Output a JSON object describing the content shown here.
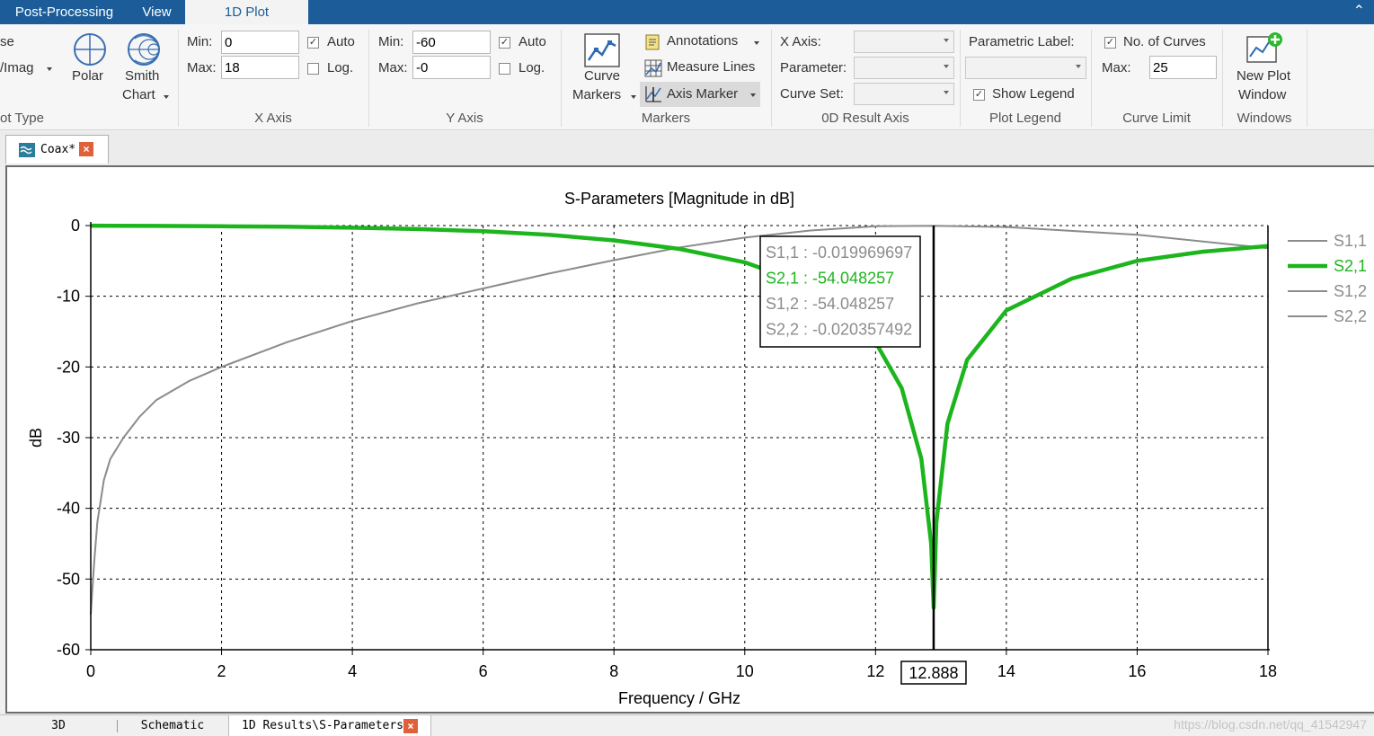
{
  "tabs": {
    "post_processing": "Post-Processing",
    "view": "View",
    "plot1d": "1D Plot"
  },
  "ribbon": {
    "plot_type": {
      "row1_partial": "se",
      "row2_partial": "/Imag",
      "label_partial": "ot Type",
      "polar": "Polar",
      "smith_line1": "Smith",
      "smith_line2": "Chart"
    },
    "x_axis": {
      "min_label": "Min:",
      "min_value": "0",
      "max_label": "Max:",
      "max_value": "18",
      "auto_label": "Auto",
      "auto_checked": true,
      "log_label": "Log.",
      "log_checked": false,
      "group_label": "X Axis"
    },
    "y_axis": {
      "min_label": "Min:",
      "min_value": "-60",
      "max_label": "Max:",
      "max_value": "-0",
      "auto_label": "Auto",
      "auto_checked": true,
      "log_label": "Log.",
      "log_checked": false,
      "group_label": "Y Axis"
    },
    "markers": {
      "curve_line1": "Curve",
      "curve_line2": "Markers",
      "annotations": "Annotations",
      "measure_lines": "Measure Lines",
      "axis_marker": "Axis Marker",
      "group_label": "Markers"
    },
    "result_axis": {
      "x_axis_label": "X Axis:",
      "parameter_label": "Parameter:",
      "curve_set_label": "Curve Set:",
      "group_label": "0D Result Axis"
    },
    "plot_legend": {
      "parametric_label": "Parametric Label:",
      "show_legend": "Show Legend",
      "show_legend_checked": true,
      "group_label": "Plot Legend"
    },
    "curve_limit": {
      "no_of_curves": "No. of Curves",
      "no_of_curves_checked": true,
      "max_label": "Max:",
      "max_value": "25",
      "group_label": "Curve Limit"
    },
    "windows": {
      "new_plot_line1": "New Plot",
      "new_plot_line2": "Window",
      "group_label": "Windows"
    }
  },
  "doc_tab": {
    "label": "Coax*",
    "close": "×"
  },
  "bottom_tabs": {
    "tab_3d": "3D",
    "schematic": "Schematic",
    "results": "1D Results\\S-Parameters",
    "close": "×"
  },
  "watermark": "https://blog.csdn.net/qq_41542947",
  "colors": {
    "ribbon_blue": "#1c5d99",
    "s21_green": "#1db51d",
    "gray_curve": "#8c8c8c",
    "tooltip_green": "#1db51d"
  },
  "chart_data": {
    "type": "line",
    "title": "S-Parameters [Magnitude in dB]",
    "xlabel": "Frequency / GHz",
    "ylabel": "dB",
    "xlim": [
      0,
      18
    ],
    "ylim": [
      -60,
      0
    ],
    "xticks": [
      0,
      2,
      4,
      6,
      8,
      10,
      12,
      14,
      16,
      18
    ],
    "yticks": [
      0,
      -10,
      -20,
      -30,
      -40,
      -50,
      -60
    ],
    "grid": true,
    "legend_position": "right",
    "legend": [
      "S1,1",
      "S2,1",
      "S1,2",
      "S2,2"
    ],
    "series": [
      {
        "name": "S1,1",
        "x": [
          0,
          0.05,
          0.1,
          0.2,
          0.3,
          0.5,
          0.75,
          1,
          1.5,
          2,
          3,
          4,
          5,
          6,
          7,
          8,
          9,
          10,
          11,
          12,
          12.888,
          14,
          16,
          18
        ],
        "values": [
          -55,
          -48,
          -42,
          -36,
          -33,
          -30,
          -27,
          -24.7,
          -22,
          -20,
          -16.5,
          -13.5,
          -11,
          -8.9,
          -6.8,
          -4.9,
          -3.1,
          -1.7,
          -0.7,
          -0.1,
          -0.02,
          -0.2,
          -1.3,
          -3.2
        ]
      },
      {
        "name": "S2,1",
        "x": [
          0,
          1,
          2,
          3,
          4,
          5,
          6,
          7,
          8,
          9,
          10,
          11,
          11.5,
          12,
          12.4,
          12.7,
          12.85,
          12.888,
          12.93,
          13.1,
          13.4,
          14,
          15,
          16,
          17,
          18
        ],
        "values": [
          -0.01,
          -0.05,
          -0.1,
          -0.15,
          -0.3,
          -0.5,
          -0.8,
          -1.3,
          -2.1,
          -3.3,
          -5.2,
          -8.5,
          -11.5,
          -16.5,
          -23,
          -33,
          -45,
          -54.05,
          -42,
          -28,
          -19,
          -12,
          -7.5,
          -5,
          -3.7,
          -2.9
        ]
      },
      {
        "name": "S1,2",
        "x": [
          0,
          1,
          2,
          3,
          4,
          5,
          6,
          7,
          8,
          9,
          10,
          11,
          11.5,
          12,
          12.4,
          12.7,
          12.85,
          12.888,
          12.93,
          13.1,
          13.4,
          14,
          15,
          16,
          17,
          18
        ],
        "values": [
          -0.01,
          -0.05,
          -0.1,
          -0.15,
          -0.3,
          -0.5,
          -0.8,
          -1.3,
          -2.1,
          -3.3,
          -5.2,
          -8.5,
          -11.5,
          -16.5,
          -23,
          -33,
          -45,
          -54.05,
          -42,
          -28,
          -19,
          -12,
          -7.5,
          -5,
          -3.7,
          -2.9
        ]
      },
      {
        "name": "S2,2",
        "x": [
          0,
          0.05,
          0.1,
          0.2,
          0.3,
          0.5,
          0.75,
          1,
          1.5,
          2,
          3,
          4,
          5,
          6,
          7,
          8,
          9,
          10,
          11,
          12,
          12.888,
          14,
          16,
          18
        ],
        "values": [
          -55,
          -48,
          -42,
          -36,
          -33,
          -30,
          -27,
          -24.7,
          -22,
          -20,
          -16.5,
          -13.5,
          -11,
          -8.9,
          -6.8,
          -4.9,
          -3.1,
          -1.7,
          -0.7,
          -0.1,
          -0.02,
          -0.2,
          -1.3,
          -3.2
        ]
      }
    ],
    "axis_marker": {
      "x": 12.888,
      "label": "12.888",
      "readout": [
        "S1,1 : -0.019969697",
        "S2,1 : -54.048257",
        "S1,2 : -54.048257",
        "S2,2 : -0.020357492"
      ]
    }
  }
}
